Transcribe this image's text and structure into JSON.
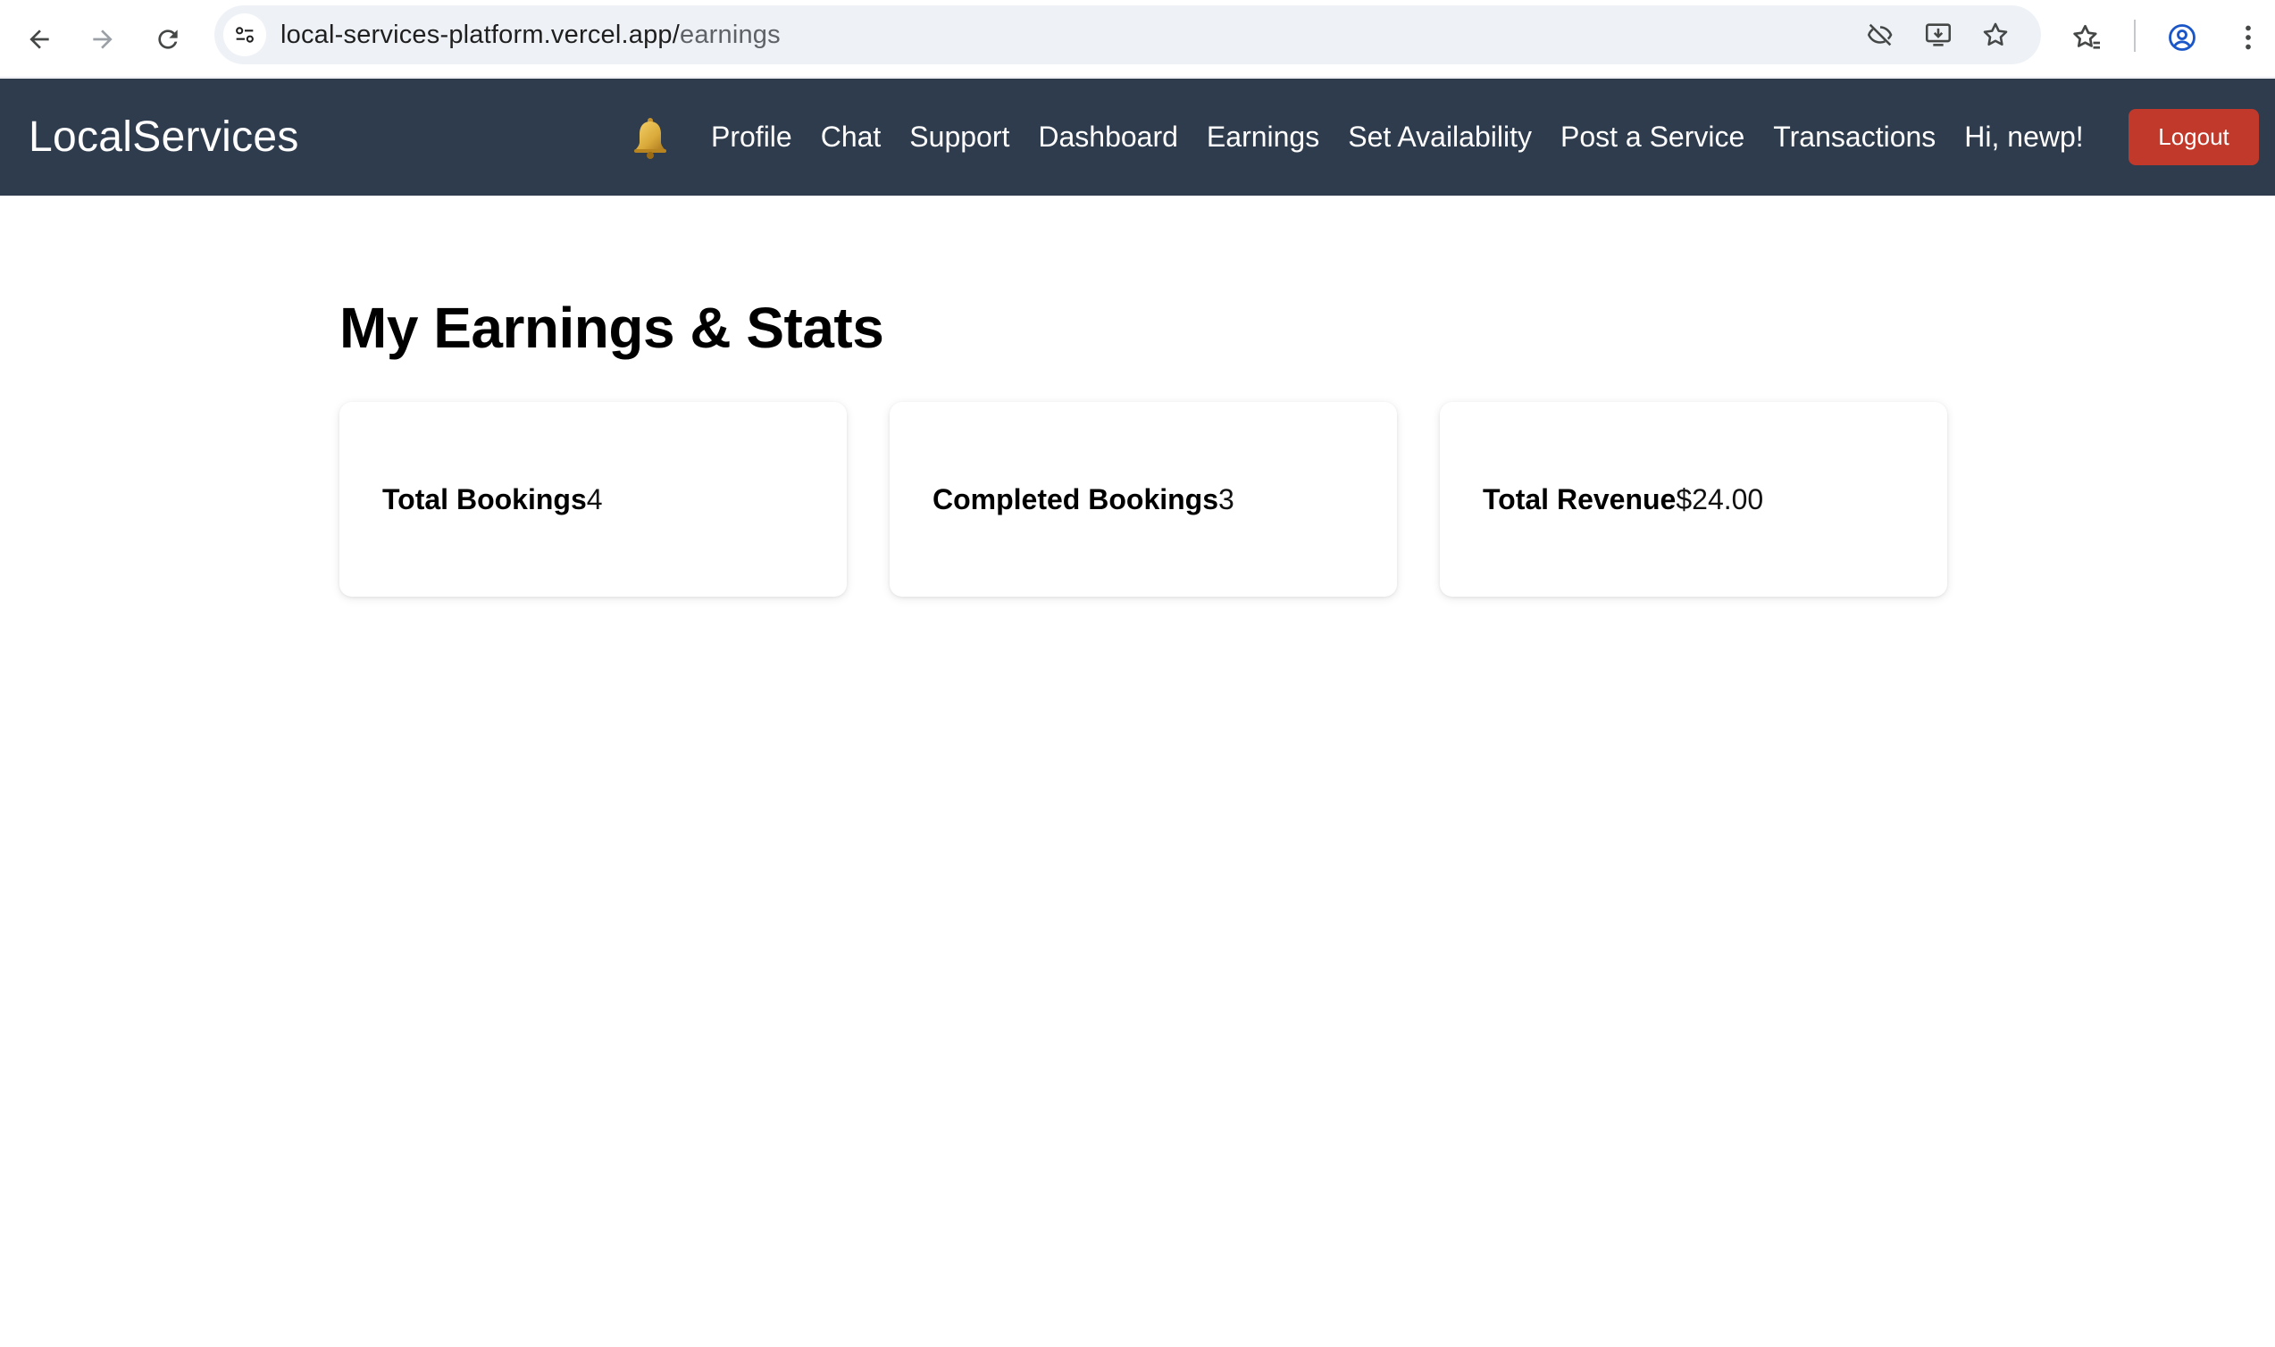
{
  "browser": {
    "url_host": "local-services-platform.vercel.app/",
    "url_path": "earnings"
  },
  "header": {
    "brand": "LocalServices",
    "nav": [
      "Profile",
      "Chat",
      "Support",
      "Dashboard",
      "Earnings",
      "Set Availability",
      "Post a Service",
      "Transactions"
    ],
    "greeting": "Hi, newp!",
    "logout_label": "Logout"
  },
  "main": {
    "title": "My Earnings & Stats",
    "stats": [
      {
        "label": "Total Bookings",
        "value": "4"
      },
      {
        "label": "Completed Bookings",
        "value": "3"
      },
      {
        "label": "Total Revenue",
        "value": "$24.00"
      }
    ]
  },
  "colors": {
    "header_bg": "#2f3c4e",
    "logout_bg": "#c0392b",
    "omnibox_bg": "#eef2f7"
  }
}
